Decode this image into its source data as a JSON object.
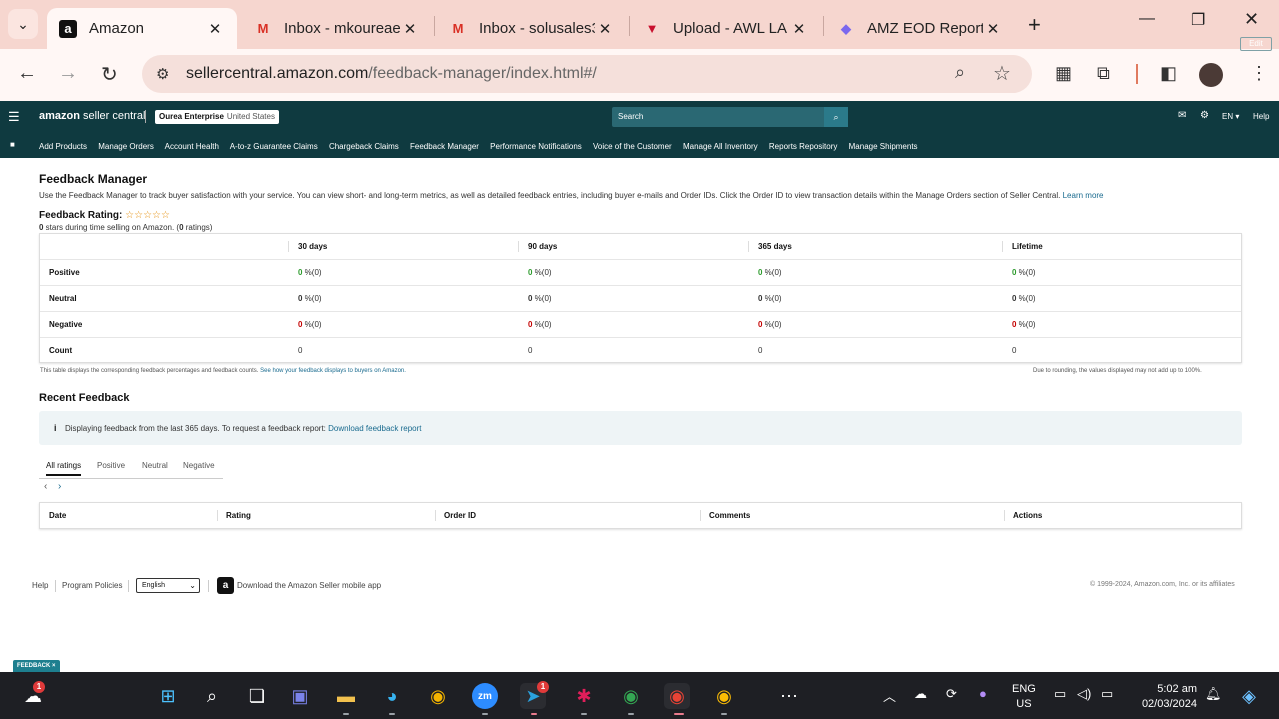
{
  "browser": {
    "tabs": [
      {
        "title": "Amazon",
        "icon": "amazon-icon"
      },
      {
        "title": "Inbox - mkoureae",
        "icon": "gmail-icon"
      },
      {
        "title": "Inbox - solusales3",
        "icon": "gmail-icon"
      },
      {
        "title": "Upload - AWL LA",
        "icon": "upload-app-icon"
      },
      {
        "title": "AMZ EOD Report",
        "icon": "clickup-icon"
      }
    ],
    "url_domain": "sellercentral.amazon.com",
    "url_path": "/feedback-manager/index.html#/"
  },
  "header": {
    "logo_bold": "amazon",
    "logo_light": " seller central",
    "store_name": "Ourea Enterprise",
    "store_region": "United States",
    "search_placeholder": "Search",
    "language": "EN",
    "help": "Help",
    "edit": "Edit",
    "nav_links": [
      "Add Products",
      "Manage Orders",
      "Account Health",
      "A-to-z Guarantee Claims",
      "Chargeback Claims",
      "Feedback Manager",
      "Performance Notifications",
      "Voice of the Customer",
      "Manage All Inventory",
      "Reports Repository",
      "Manage Shipments"
    ]
  },
  "page": {
    "title": "Feedback Manager",
    "description": "Use the Feedback Manager to track buyer satisfaction with your service. You can view short- and long-term metrics, as well as detailed feedback entries, including buyer e-mails and Order IDs. Click the Order ID to view transaction details within the Manage Orders section of Seller Central.",
    "learn_more": "Learn more",
    "rating_label": "Feedback Rating:",
    "rating_stars": "☆☆☆☆☆",
    "stars_count": "0",
    "stars_text": " stars during time selling on Amazon. (",
    "ratings_count": "0",
    "ratings_text": " ratings)",
    "columns": [
      "30 days",
      "90 days",
      "365 days",
      "Lifetime"
    ],
    "rows": [
      {
        "label": "Positive",
        "values": [
          "0",
          "0",
          "0",
          "0"
        ],
        "suffix": " %(0)"
      },
      {
        "label": "Neutral",
        "values": [
          "0",
          "0",
          "0",
          "0"
        ],
        "suffix": " %(0)"
      },
      {
        "label": "Negative",
        "values": [
          "0",
          "0",
          "0",
          "0"
        ],
        "suffix": " %(0)"
      },
      {
        "label": "Count",
        "values": [
          "0",
          "0",
          "0",
          "0"
        ],
        "suffix": ""
      }
    ],
    "table_note_left": "This table displays the corresponding feedback percentages and feedback counts.",
    "table_note_link": "See how your feedback displays to buyers on Amazon.",
    "table_note_right": "Due to rounding, the values displayed may not add up to 100%.",
    "recent_title": "Recent Feedback",
    "info_text": "Displaying feedback from the last 365 days. To request a feedback report:",
    "info_link": "Download feedback report",
    "filter_tabs": [
      "All ratings",
      "Positive",
      "Neutral",
      "Negative"
    ],
    "recent_columns": [
      "Date",
      "Rating",
      "Order ID",
      "Comments",
      "Actions"
    ]
  },
  "footer": {
    "help": "Help",
    "program_policies": "Program Policies",
    "language_value": "English",
    "app_text": "Download the Amazon Seller mobile app",
    "copyright": "© 1999-2024, Amazon.com, Inc. or its affiliates",
    "feedback_tag": "FEEDBACK"
  },
  "taskbar": {
    "weather_badge": "1",
    "telegram_badge": "1",
    "lang_line1": "ENG",
    "lang_line2": "US",
    "time": "5:02 am",
    "date": "02/03/2024"
  },
  "colors": {
    "header_bg": "#0f3a40",
    "tabstrip_bg": "#f6d6cf",
    "positive": "#2b9a2b",
    "negative": "#c40000",
    "link": "#1a6b8f"
  }
}
